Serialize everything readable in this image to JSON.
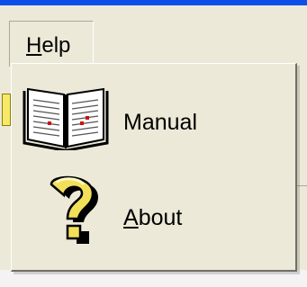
{
  "menubar": {
    "help_label": "Help"
  },
  "help_menu": {
    "items": [
      {
        "label": "Manual",
        "icon": "book-icon"
      },
      {
        "label": "About",
        "icon": "question-mark-icon"
      }
    ]
  },
  "colors": {
    "menu_background": "#ece9d8",
    "title_bar": "#0a50e8",
    "icon_yellow": "#f2e05a"
  }
}
